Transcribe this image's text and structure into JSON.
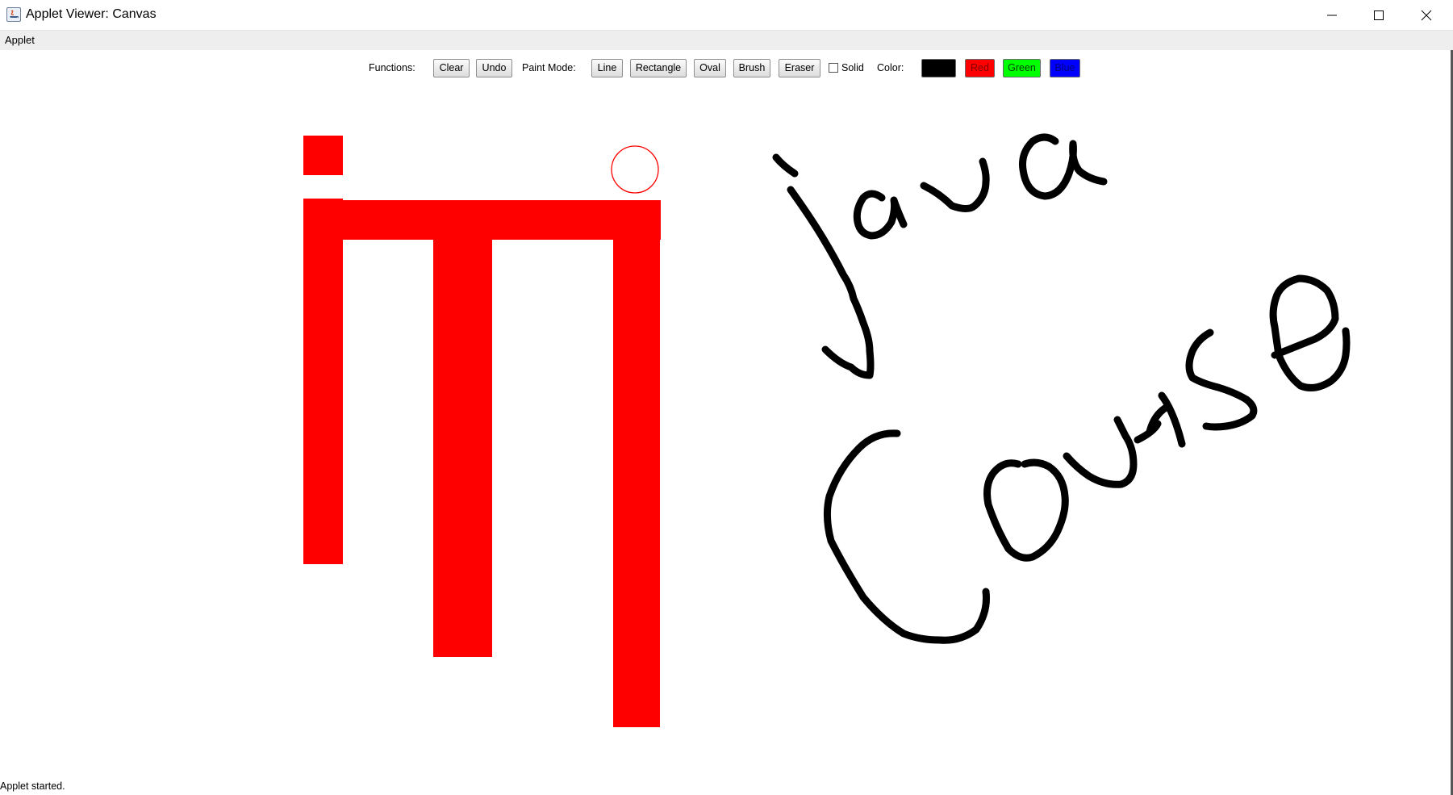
{
  "window": {
    "title": "Applet Viewer: Canvas",
    "controls": [
      "minimize-icon",
      "maximize-icon",
      "close-icon"
    ]
  },
  "menubar": {
    "items": [
      {
        "label": "Applet"
      }
    ]
  },
  "toolbar": {
    "functions_label": "Functions:",
    "clear_label": "Clear",
    "undo_label": "Undo",
    "paint_mode_label": "Paint Mode:",
    "line_label": "Line",
    "rectangle_label": "Rectangle",
    "oval_label": "Oval",
    "brush_label": "Brush",
    "eraser_label": "Eraser",
    "solid_label": "Solid",
    "solid_checked": false,
    "color_label": "Color:",
    "colors": [
      {
        "label": "",
        "color": "#000000"
      },
      {
        "label": "Red",
        "color": "#ff0000"
      },
      {
        "label": "Green",
        "color": "#00ff00"
      },
      {
        "label": "Blue",
        "color": "#0000ff"
      }
    ]
  },
  "canvas": {
    "shape_color": "#ff0000",
    "ink_color": "#000000",
    "handwriting_1": "Java",
    "handwriting_2": "Course"
  },
  "status": {
    "text": "Applet started."
  }
}
